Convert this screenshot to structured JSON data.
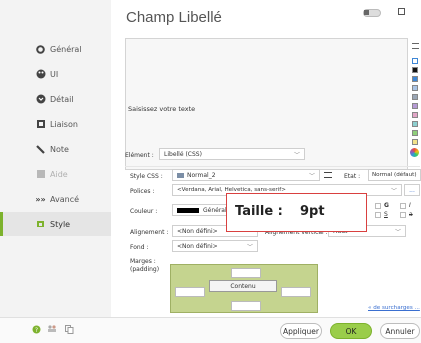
{
  "title": "Champ Libellé",
  "nav": [
    {
      "label": "Général"
    },
    {
      "label": "UI"
    },
    {
      "label": "Détail"
    },
    {
      "label": "Liaison"
    },
    {
      "label": "Note"
    },
    {
      "label": "Aide"
    },
    {
      "label": "Avancé"
    },
    {
      "label": "Style"
    }
  ],
  "text_area": {
    "text": "Saisissez votre texte"
  },
  "element": {
    "label": "Elément :",
    "value": "Libellé (CSS)"
  },
  "style_css": {
    "label": "Style CSS :",
    "value": "Normal_2",
    "etat_label": "Etat :",
    "etat_value": "Normal (défaut)"
  },
  "police": {
    "label": "Polices :",
    "value": "<Verdana, Arial, Helvetica, sans-serif>",
    "more": "..."
  },
  "couleur": {
    "label": "Couleur :",
    "value": "Général (",
    "bold": "G",
    "italic": "I",
    "underline": "S",
    "strike": "a"
  },
  "tooltip": {
    "label": "Taille :",
    "value": "9pt"
  },
  "alignement": {
    "label": "Alignement :",
    "value": "<Non défini>",
    "vertical_label": "Alignement vertical :",
    "vertical_value": "Haut"
  },
  "fond": {
    "label": "Fond :",
    "value": "<Non défini>"
  },
  "marges": {
    "label1": "Marges :",
    "label2": "(padding)",
    "content_label": "Contenu"
  },
  "surcharges_link": "« de surcharges ...",
  "footer": {
    "apply": "Appliquer",
    "ok": "OK",
    "cancel": "Annuler"
  },
  "colors": {
    "accent": "#7db22d",
    "ok_button": "#9acd4a",
    "margin_box": "#c5d48f",
    "tooltip_border": "#d9403f"
  }
}
